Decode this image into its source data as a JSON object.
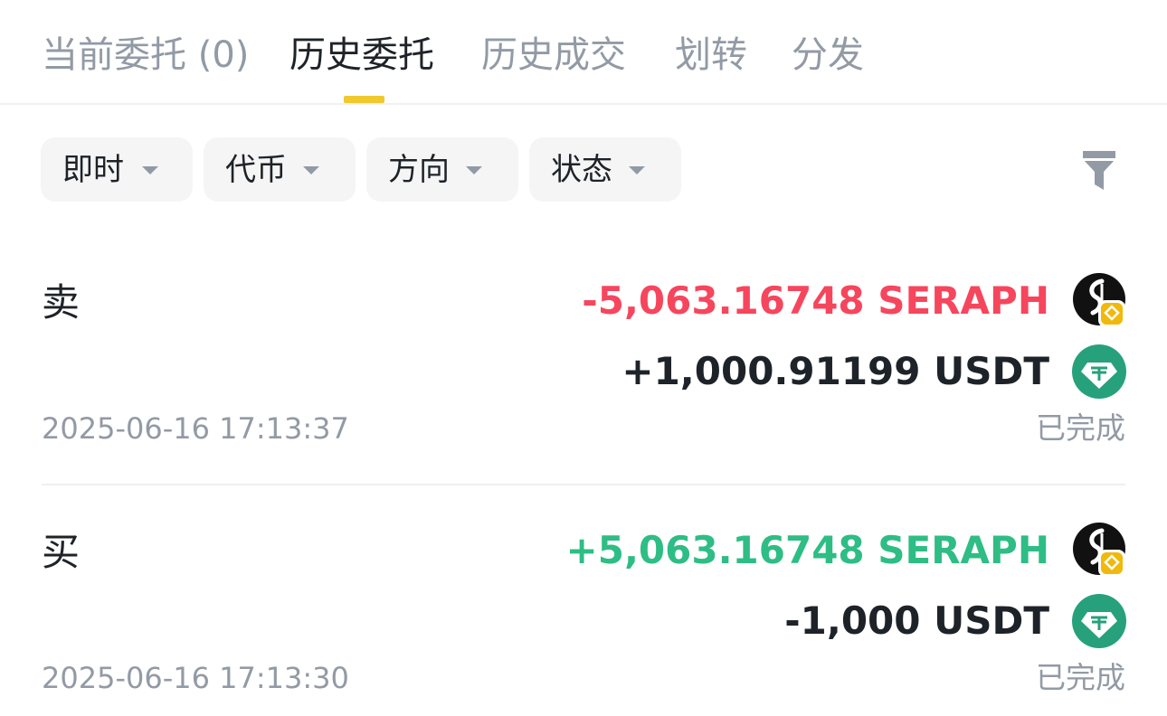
{
  "tabs": {
    "open_orders": "当前委托 (0)",
    "order_history": "历史委托",
    "trade_history": "历史成交",
    "transfers": "划转",
    "distribution": "分发"
  },
  "filters": {
    "type": "即时",
    "coin": "代币",
    "direction": "方向",
    "status": "状态"
  },
  "orders": [
    {
      "side": "卖",
      "base_amount": "-5,063.16748 SERAPH",
      "quote_amount": "+1,000.91199 USDT",
      "time": "2025-06-16 17:13:37",
      "status": "已完成"
    },
    {
      "side": "买",
      "base_amount": "+5,063.16748 SERAPH",
      "quote_amount": "-1,000 USDT",
      "time": "2025-06-16 17:13:30",
      "status": "已完成"
    }
  ],
  "colors": {
    "sell": "#f6465d",
    "buy": "#2ebd85",
    "accent": "#f0c92d",
    "muted": "#929aa5",
    "usdt": "#26a17b"
  },
  "icons": {
    "filter": "funnel-icon",
    "dropdown": "caret-down-icon",
    "base_coin": "seraph-coin-icon",
    "chain_badge": "bnb-chain-badge-icon",
    "quote_coin": "usdt-coin-icon"
  }
}
